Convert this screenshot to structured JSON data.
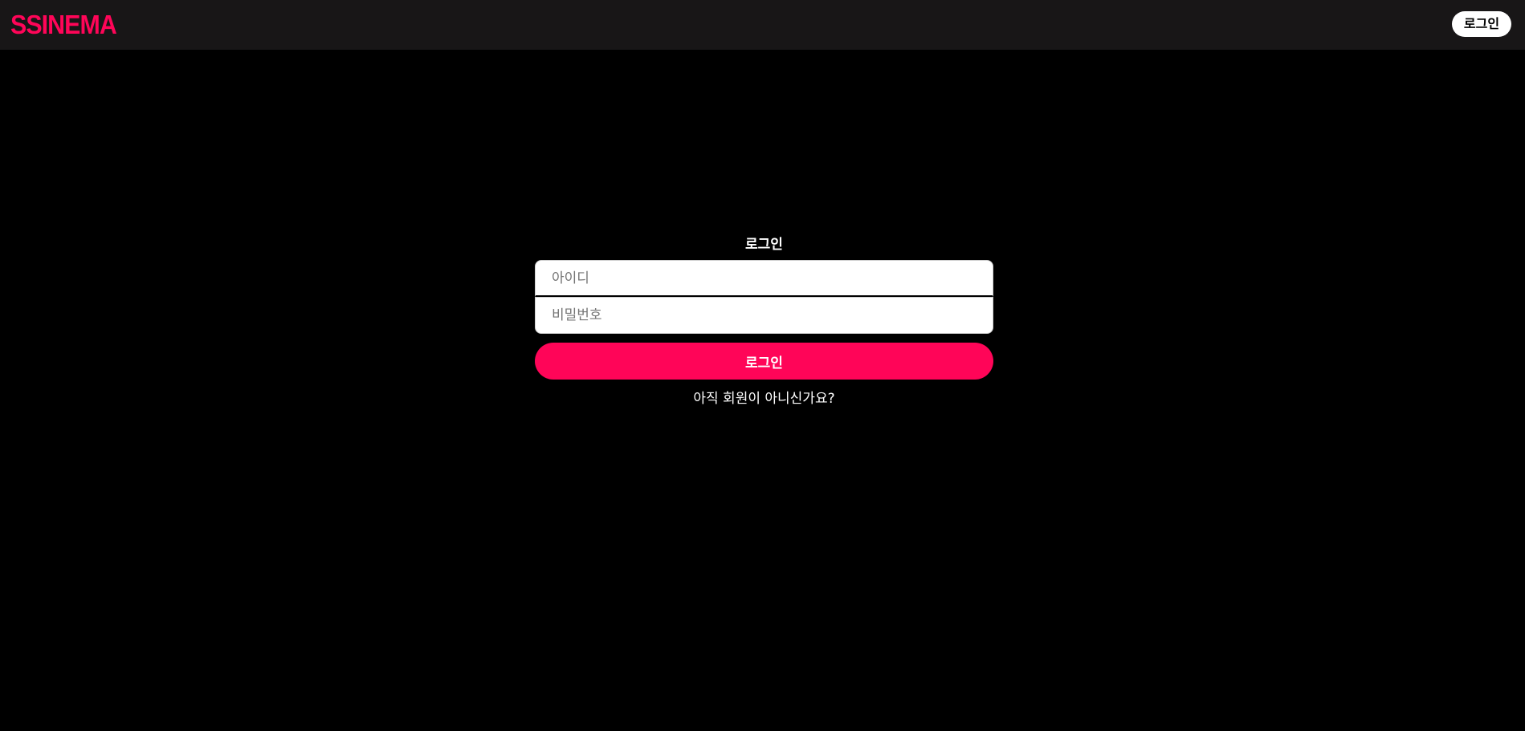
{
  "header": {
    "logo": "SSINEMA",
    "login_label": "로그인"
  },
  "login_form": {
    "title": "로그인",
    "id_placeholder": "아이디",
    "password_placeholder": "비밀번호",
    "submit_label": "로그인",
    "signup_link": "아직 회원이 아니신가요?"
  },
  "colors": {
    "accent": "#ff0558",
    "header_background": "#181617",
    "page_background": "#000000"
  }
}
